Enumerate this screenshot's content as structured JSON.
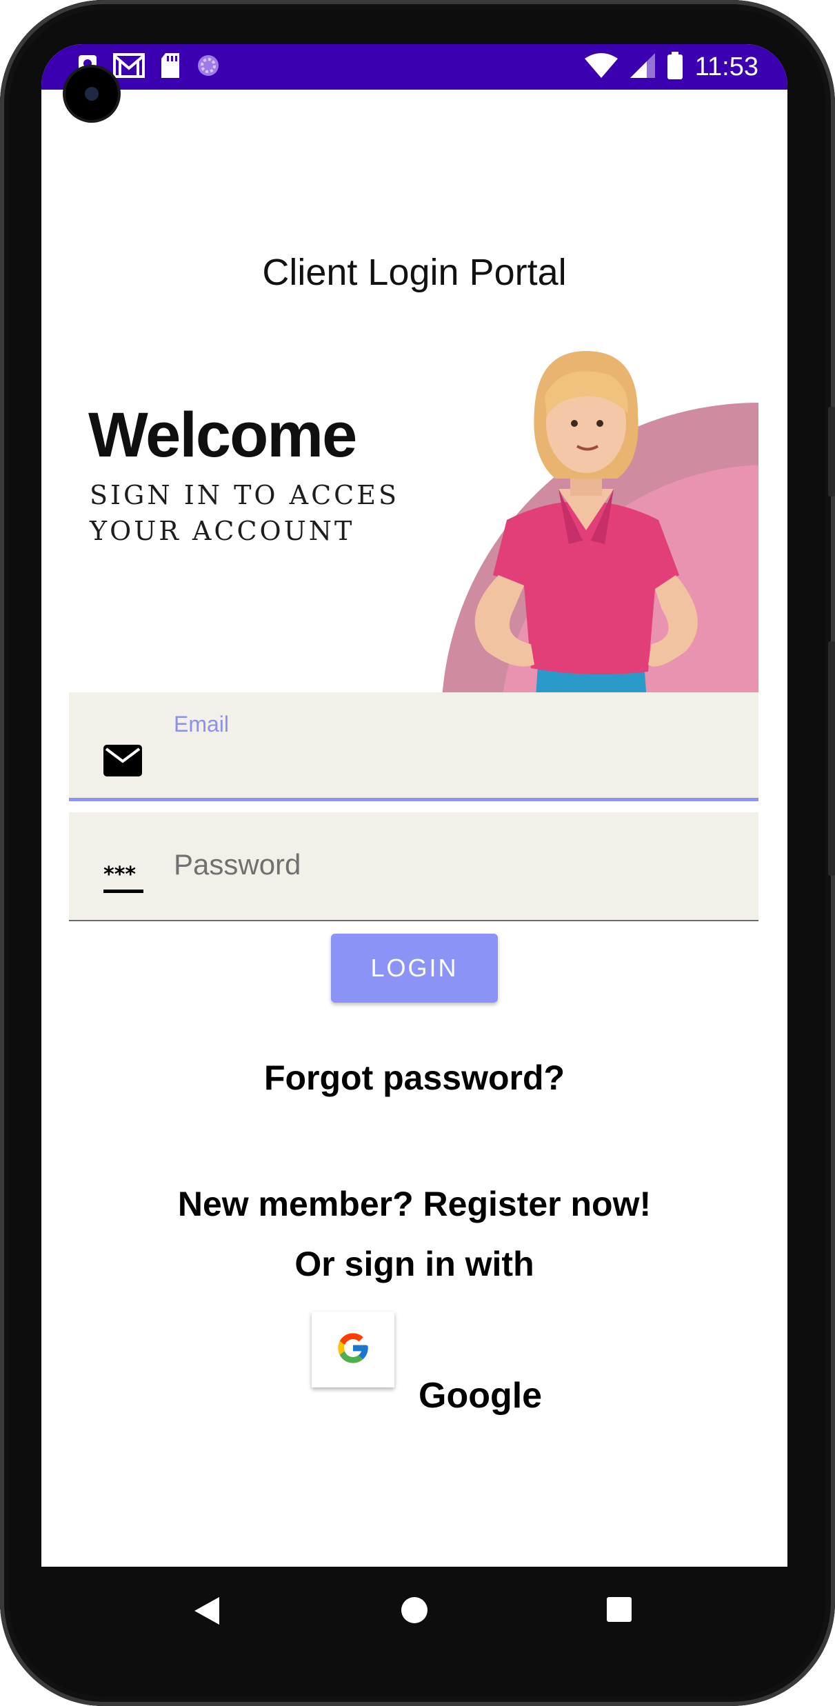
{
  "status_bar": {
    "time": "11:53",
    "icons_left": [
      "notification-icon",
      "gmail-icon",
      "sd-card-icon",
      "loading-icon"
    ],
    "icons_right": [
      "wifi-icon",
      "signal-icon",
      "battery-icon"
    ],
    "color": "#3b00b0"
  },
  "page": {
    "title": "Client Login Portal"
  },
  "banner": {
    "heading": "Welcome",
    "subtitle": "SIGN IN TO ACCES\nYOUR ACCOUNT"
  },
  "form": {
    "email_label": "Email",
    "email_value": "",
    "password_placeholder": "Password",
    "login_label": "LOGIN",
    "accent_color": "#8b93f7"
  },
  "links": {
    "forgot_password": "Forgot password?",
    "register": "New member? Register now!",
    "or_sign_in": "Or sign in with",
    "google_label": "Google"
  },
  "navigation": {
    "buttons": [
      "back-icon",
      "home-icon",
      "recents-icon"
    ]
  }
}
